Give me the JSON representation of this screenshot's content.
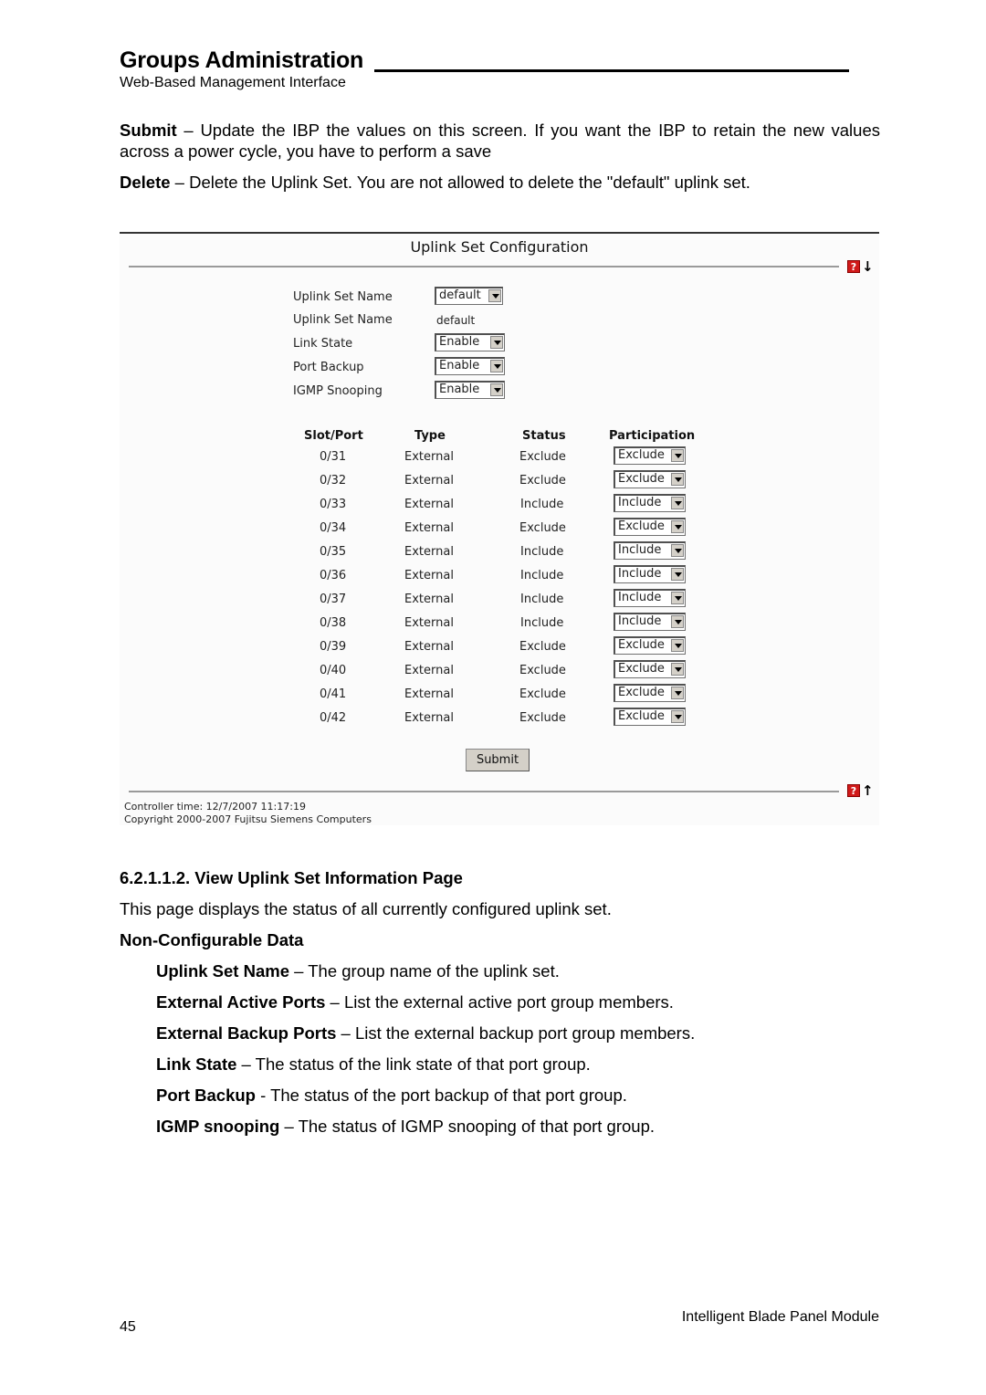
{
  "header": {
    "title": "Groups Administration",
    "subtitle": "Web-Based Management Interface"
  },
  "intro": [
    {
      "term": "Submit",
      "sep": " – ",
      "text": "Update the IBP the values on this screen. If you want the IBP to retain the new values across a power cycle, you have to perform a save"
    },
    {
      "term": "Delete",
      "sep": " – ",
      "text": "Delete the Uplink Set. You are not allowed to delete the \"default\" uplink set."
    }
  ],
  "panel": {
    "title": "Uplink Set Configuration",
    "icons": {
      "help": "help-icon",
      "down": "arrow-down-icon",
      "up": "arrow-up-icon",
      "help_glyph": "?",
      "down_glyph": "🡇",
      "up_glyph": "🡅"
    },
    "fields": [
      {
        "label": "Uplink Set Name",
        "type": "select",
        "value": "default"
      },
      {
        "label": "Uplink Set Name",
        "type": "text",
        "value": "default"
      },
      {
        "label": "Link State",
        "type": "select",
        "value": "Enable"
      },
      {
        "label": "Port Backup",
        "type": "select",
        "value": "Enable"
      },
      {
        "label": "IGMP Snooping",
        "type": "select",
        "value": "Enable"
      }
    ],
    "table": {
      "headers": [
        "Slot/Port",
        "Type",
        "Status",
        "Participation"
      ],
      "rows": [
        {
          "port": "0/31",
          "type": "External",
          "status": "Exclude",
          "participation": "Exclude"
        },
        {
          "port": "0/32",
          "type": "External",
          "status": "Exclude",
          "participation": "Exclude"
        },
        {
          "port": "0/33",
          "type": "External",
          "status": "Include",
          "participation": "Include"
        },
        {
          "port": "0/34",
          "type": "External",
          "status": "Exclude",
          "participation": "Exclude"
        },
        {
          "port": "0/35",
          "type": "External",
          "status": "Include",
          "participation": "Include"
        },
        {
          "port": "0/36",
          "type": "External",
          "status": "Include",
          "participation": "Include"
        },
        {
          "port": "0/37",
          "type": "External",
          "status": "Include",
          "participation": "Include"
        },
        {
          "port": "0/38",
          "type": "External",
          "status": "Include",
          "participation": "Include"
        },
        {
          "port": "0/39",
          "type": "External",
          "status": "Exclude",
          "participation": "Exclude"
        },
        {
          "port": "0/40",
          "type": "External",
          "status": "Exclude",
          "participation": "Exclude"
        },
        {
          "port": "0/41",
          "type": "External",
          "status": "Exclude",
          "participation": "Exclude"
        },
        {
          "port": "0/42",
          "type": "External",
          "status": "Exclude",
          "participation": "Exclude"
        }
      ]
    },
    "submit_label": "Submit",
    "controller_time": "Controller time: 12/7/2007 11:17:19",
    "copyright": "Copyright 2000-2007 Fujitsu Siemens Computers"
  },
  "section": {
    "heading": "6.2.1.1.2. View Uplink Set Information Page",
    "description": "This page displays the status of all currently configured uplink set.",
    "subheading": "Non-Configurable Data",
    "items": [
      {
        "term": "Uplink Set Name",
        "sep": " – ",
        "text": "The group name of the uplink set."
      },
      {
        "term": "External Active Ports",
        "sep": " – ",
        "text": "List the external active port group members."
      },
      {
        "term": "External Backup Ports",
        "sep": " – ",
        "text": "List the external backup port group members."
      },
      {
        "term": "Link State",
        "sep": " – ",
        "text": "The status of the link state of that port group."
      },
      {
        "term": "Port Backup",
        "sep": " - ",
        "text": "The status of the port backup of that port group."
      },
      {
        "term": "IGMP snooping",
        "sep": " – ",
        "text": "The status of IGMP snooping of that port group."
      }
    ]
  },
  "footer": {
    "page_number": "45",
    "doc_title": "Intelligent Blade Panel Module"
  }
}
